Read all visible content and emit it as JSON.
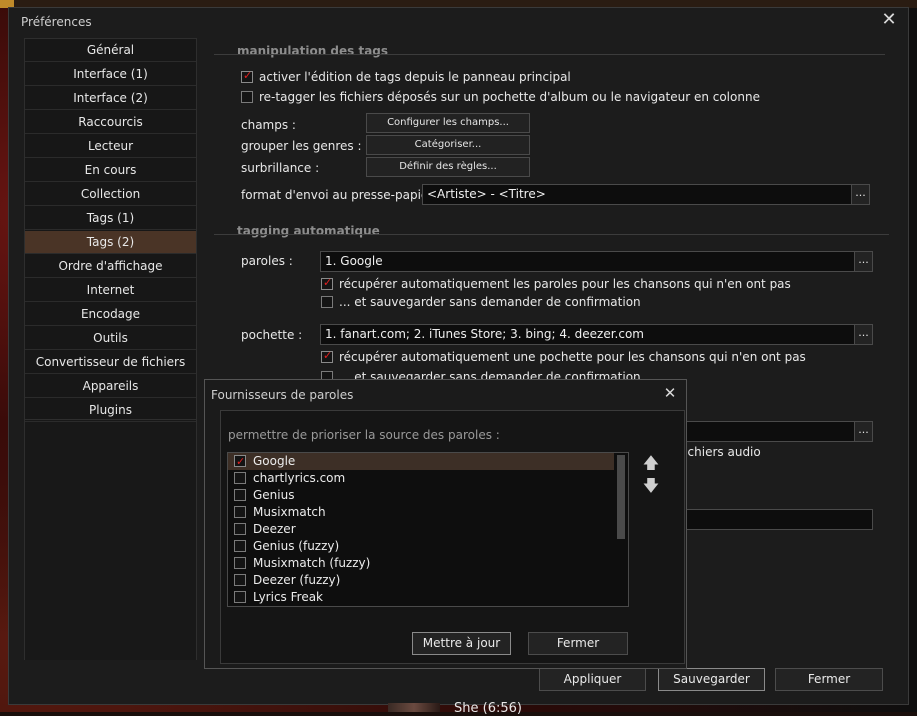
{
  "window": {
    "title": "Préférences",
    "close_glyph": "✕"
  },
  "sidebar": {
    "items": [
      {
        "label": "Général"
      },
      {
        "label": "Interface (1)"
      },
      {
        "label": "Interface (2)"
      },
      {
        "label": "Raccourcis"
      },
      {
        "label": "Lecteur"
      },
      {
        "label": "En cours"
      },
      {
        "label": "Collection"
      },
      {
        "label": "Tags (1)"
      },
      {
        "label": "Tags (2)",
        "selected": true
      },
      {
        "label": "Ordre d'affichage"
      },
      {
        "label": "Internet"
      },
      {
        "label": "Encodage"
      },
      {
        "label": "Outils"
      },
      {
        "label": "Convertisseur de fichiers"
      },
      {
        "label": "Appareils"
      },
      {
        "label": "Plugins"
      }
    ]
  },
  "tag_editing": {
    "header": "manipulation des tags",
    "enable_editing": {
      "label": "activer l'édition de tags depuis le panneau principal",
      "checked": true
    },
    "retag_dropped": {
      "label": "re-tagger les fichiers déposés sur un pochette d'album ou le navigateur en colonne",
      "checked": false
    },
    "fields": {
      "label": "champs :",
      "button": "Configurer les champs..."
    },
    "group_genres": {
      "label": "grouper les genres :",
      "button": "Catégoriser..."
    },
    "highlight": {
      "label": "surbrillance :",
      "button": "Définir des règles..."
    },
    "clipboard": {
      "label": "format d'envoi au presse-papier :",
      "value": "<Artiste> - <Titre>",
      "more": "..."
    }
  },
  "auto_tagging": {
    "header": "tagging automatique",
    "lyrics": {
      "label": "paroles :",
      "value": "1. Google",
      "more": "...",
      "auto_fetch": {
        "label": "récupérer automatiquement les paroles pour les chansons qui n'en ont pas",
        "checked": true
      },
      "save_without_confirm": {
        "label": "... et sauvegarder sans demander de confirmation",
        "checked": false
      }
    },
    "artwork": {
      "label": "pochette :",
      "value": "1. fanart.com; 2. iTunes Store; 3. bing; 4. deezer.com",
      "more": "...",
      "auto_fetch": {
        "label": "récupérer automatiquement une pochette pour les chansons qui n'en ont pas",
        "checked": true
      },
      "save_without_confirm": {
        "label": "... et sauvegarder sans demander de confirmation",
        "checked": false
      }
    },
    "hidden_row_more": "...",
    "hidden_row_text": "fichiers audio"
  },
  "footer": {
    "apply": "Appliquer",
    "save": "Sauvegarder",
    "close": "Fermer"
  },
  "dialog": {
    "title": "Fournisseurs de paroles",
    "close_glyph": "✕",
    "hint": "permettre de prioriser la source des paroles :",
    "providers": [
      {
        "label": "Google",
        "checked": true,
        "selected": true
      },
      {
        "label": "chartlyrics.com",
        "checked": false
      },
      {
        "label": "Genius",
        "checked": false
      },
      {
        "label": "Musixmatch",
        "checked": false
      },
      {
        "label": "Deezer",
        "checked": false
      },
      {
        "label": "Genius (fuzzy)",
        "checked": false
      },
      {
        "label": "Musixmatch (fuzzy)",
        "checked": false
      },
      {
        "label": "Deezer (fuzzy)",
        "checked": false
      },
      {
        "label": "Lyrics Freak",
        "checked": false
      }
    ],
    "move_up_glyph": "🡅",
    "move_down_glyph": "🡇",
    "update_button": "Mettre à jour",
    "close_button": "Fermer"
  },
  "now_playing": {
    "text": "She (6:56)"
  },
  "colors": {
    "accent": "#4a3426",
    "check": "#e02020",
    "window_bg": "#1c1c1c"
  }
}
